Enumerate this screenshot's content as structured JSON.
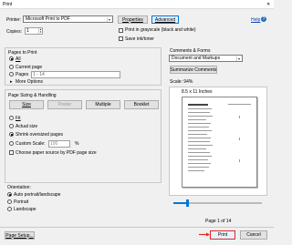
{
  "window": {
    "title": "Print"
  },
  "printer": {
    "label": "Printer:",
    "selected": "Microsoft Print to PDF",
    "properties": "Properties",
    "advanced": "Advanced",
    "help": "Help"
  },
  "copies": {
    "label": "Copies:",
    "value": "1",
    "grayscale": "Print in grayscale (black and white)",
    "save_ink": "Save ink/toner"
  },
  "pages_to_print": {
    "title": "Pages to Print",
    "all": "All",
    "current": "Current page",
    "pages": "Pages",
    "pages_value": "1 - 14",
    "more": "More Options"
  },
  "sizing": {
    "title": "Page Sizing & Handling",
    "tabs": [
      "Size",
      "Poster",
      "Multiple",
      "Booklet"
    ],
    "fit": "Fit",
    "actual": "Actual size",
    "shrink": "Shrink oversized pages",
    "custom": "Custom Scale:",
    "custom_value": "100",
    "percent": "%",
    "paper_source": "Choose paper source by PDF page size"
  },
  "orientation": {
    "title": "Orientation:",
    "auto": "Auto portrait/landscape",
    "portrait": "Portrait",
    "landscape": "Landscape"
  },
  "comments": {
    "title": "Comments & Forms",
    "selected": "Document and Markups",
    "summarize": "Summarize Comments"
  },
  "preview": {
    "scale": "Scale: 94%",
    "paper": "8.5 x 11 Inches",
    "page_indicator": "Page 1 of 14",
    "slider_level": 0.15
  },
  "footer": {
    "page_setup": "Page Setup...",
    "print": "Print",
    "cancel": "Cancel"
  },
  "colors": {
    "highlight": "#e0282d",
    "accent": "#0078d7"
  }
}
